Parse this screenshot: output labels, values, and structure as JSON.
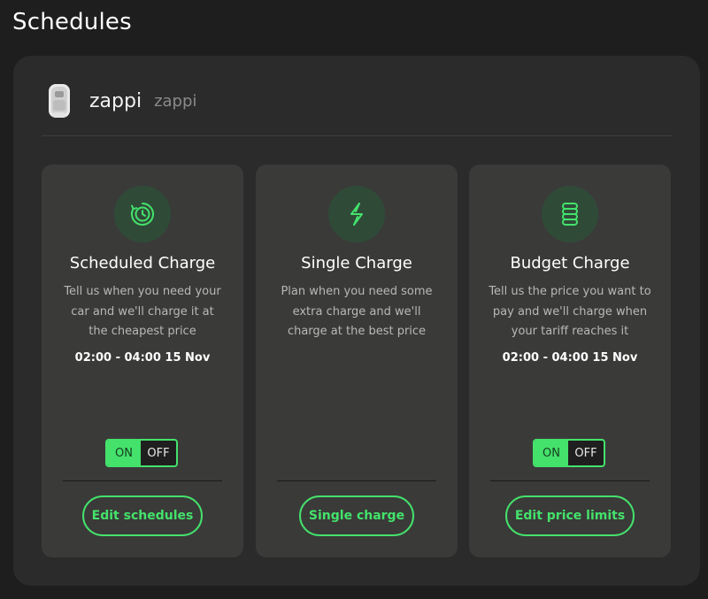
{
  "page": {
    "title": "Schedules"
  },
  "device": {
    "name": "zappi",
    "subtitle": "zappi"
  },
  "colors": {
    "accent": "#44e26b",
    "card_bg": "#3a3a39",
    "panel_bg": "#2b2b2b",
    "icon_bg": "#2f4b38"
  },
  "cards": [
    {
      "icon": "clock-icon",
      "title": "Scheduled Charge",
      "description": "Tell us when you need your car and we'll charge it at the cheapest price",
      "time": "02:00 - 04:00 15 Nov",
      "toggle": {
        "on_label": "ON",
        "off_label": "OFF",
        "state": "ON"
      },
      "button_label": "Edit schedules"
    },
    {
      "icon": "lightning-icon",
      "title": "Single Charge",
      "description": "Plan when you need some extra charge and we'll charge at the best price",
      "button_label": "Single charge"
    },
    {
      "icon": "coins-icon",
      "title": "Budget Charge",
      "description": "Tell us the price you want to pay and we'll charge when your tariff reaches it",
      "time": "02:00 - 04:00 15 Nov",
      "toggle": {
        "on_label": "ON",
        "off_label": "OFF",
        "state": "ON"
      },
      "button_label": "Edit price limits"
    }
  ]
}
